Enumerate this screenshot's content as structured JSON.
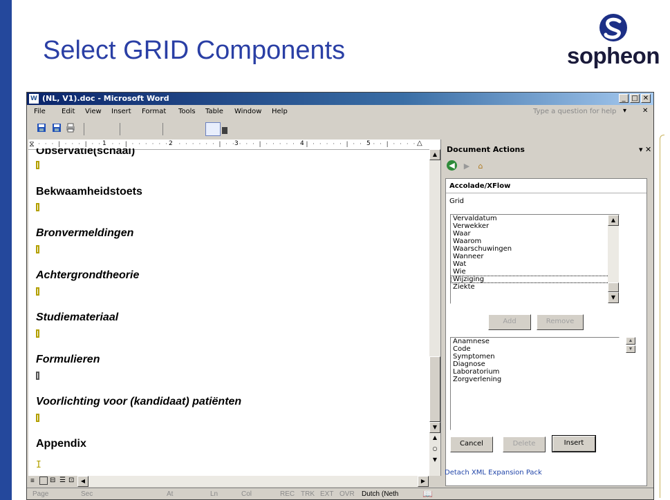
{
  "slide": {
    "title": "Select GRID Components",
    "logo_text": "sopheon",
    "accent_color": "#24489c",
    "title_color": "#2a3fa5"
  },
  "window": {
    "title": "(NL, V1).doc - Microsoft Word",
    "app_icon": "word-icon",
    "controls": [
      "minimize-icon",
      "maximize-icon",
      "close-icon"
    ]
  },
  "menu": {
    "items": [
      "File",
      "Edit",
      "View",
      "Insert",
      "Format",
      "Tools",
      "Table",
      "Window",
      "Help"
    ],
    "help_placeholder": "Type a question for help"
  },
  "toolbar": {
    "icons": [
      "save-icon",
      "save-as-icon",
      "print-icon"
    ]
  },
  "ruler": {
    "numbers": [
      "1",
      "2",
      "3",
      "4",
      "5"
    ]
  },
  "document": {
    "headings": [
      {
        "text": "Observatie(schaal)",
        "style": "bold"
      },
      {
        "text": "Bekwaamheidstoets",
        "style": "bold"
      },
      {
        "text": "Bronvermeldingen",
        "style": "bold-italic"
      },
      {
        "text": "Achtergrondtheorie",
        "style": "bold-italic"
      },
      {
        "text": "Studiemateriaal",
        "style": "bold-italic"
      },
      {
        "text": "Formulieren",
        "style": "bold-italic"
      },
      {
        "text": "Voorlichting voor (kandidaat) patiënten",
        "style": "bold-italic"
      },
      {
        "text": "Appendix",
        "style": "bold"
      }
    ]
  },
  "statusbar": {
    "page": "Page",
    "sec": "Sec",
    "at": "At",
    "ln": "Ln",
    "col": "Col",
    "rec": "REC",
    "trk": "TRK",
    "ext": "EXT",
    "ovr": "OVR",
    "language": "Dutch (Neth"
  },
  "task_pane": {
    "title": "Document Actions",
    "nav_icons": [
      "back-icon",
      "forward-icon",
      "home-icon"
    ],
    "section_title": "Accolade/XFlow",
    "grid_label": "Grid",
    "available_items": [
      "Vervaldatum",
      "Verwekker",
      "Waar",
      "Waarom",
      "Waarschuwingen",
      "Wanneer",
      "Wat",
      "Wie",
      "Wijziging",
      "Ziekte"
    ],
    "focused_item": "Wijziging",
    "add_label": "Add",
    "remove_label": "Remove",
    "selected_items": [
      "Anamnese",
      "Code",
      "Symptomen",
      "Diagnose",
      "Laboratorium",
      "Zorgverlening"
    ],
    "cancel_label": "Cancel",
    "delete_label": "Delete",
    "insert_label": "Insert",
    "detach_link": "Detach XML Expansion Pack"
  }
}
